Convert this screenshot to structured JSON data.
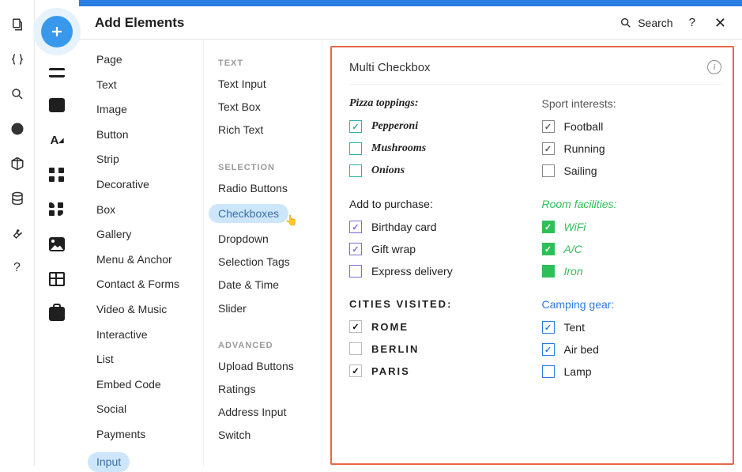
{
  "header": {
    "title": "Add Elements",
    "search_label": "Search"
  },
  "categories": [
    "Page",
    "Text",
    "Image",
    "Button",
    "Strip",
    "Decorative",
    "Box",
    "Gallery",
    "Menu & Anchor",
    "Contact & Forms",
    "Video & Music",
    "Interactive",
    "List",
    "Embed Code",
    "Social",
    "Payments",
    "Input"
  ],
  "selected_category": "Input",
  "subcats": {
    "text": {
      "heading": "TEXT",
      "items": [
        "Text Input",
        "Text Box",
        "Rich Text"
      ]
    },
    "selection": {
      "heading": "SELECTION",
      "items": [
        "Radio Buttons",
        "Checkboxes",
        "Dropdown",
        "Selection Tags",
        "Date & Time",
        "Slider"
      ],
      "selected": "Checkboxes"
    },
    "advanced": {
      "heading": "ADVANCED",
      "items": [
        "Upload Buttons",
        "Ratings",
        "Address Input",
        "Switch"
      ]
    }
  },
  "preview": {
    "title": "Multi Checkbox",
    "groups": [
      {
        "id": "pizza",
        "theme": "teal",
        "title": "Pizza toppings:",
        "items": [
          {
            "label": "Pepperoni",
            "checked": true
          },
          {
            "label": "Mushrooms",
            "checked": false
          },
          {
            "label": "Onions",
            "checked": false
          }
        ]
      },
      {
        "id": "sport",
        "theme": "grey",
        "title": "Sport interests:",
        "items": [
          {
            "label": "Football",
            "checked": true
          },
          {
            "label": "Running",
            "checked": true
          },
          {
            "label": "Sailing",
            "checked": false
          }
        ]
      },
      {
        "id": "purchase",
        "theme": "violet",
        "title": "Add to purchase:",
        "items": [
          {
            "label": "Birthday card",
            "checked": true
          },
          {
            "label": "Gift wrap",
            "checked": true
          },
          {
            "label": "Express delivery",
            "checked": false
          }
        ]
      },
      {
        "id": "room",
        "theme": "green",
        "title": "Room facilities:",
        "items": [
          {
            "label": "WiFi",
            "checked": true,
            "filled": true
          },
          {
            "label": "A/C",
            "checked": true,
            "filled": true
          },
          {
            "label": "Iron",
            "checked": false,
            "filled": true
          }
        ]
      },
      {
        "id": "cities",
        "theme": "black",
        "title": "Cities visited:",
        "items": [
          {
            "label": "Rome",
            "checked": true
          },
          {
            "label": "Berlin",
            "checked": false
          },
          {
            "label": "Paris",
            "checked": true
          }
        ]
      },
      {
        "id": "camping",
        "theme": "blue",
        "title": "Camping gear:",
        "items": [
          {
            "label": "Tent",
            "checked": true
          },
          {
            "label": "Air bed",
            "checked": true
          },
          {
            "label": "Lamp",
            "checked": false
          }
        ]
      }
    ]
  }
}
